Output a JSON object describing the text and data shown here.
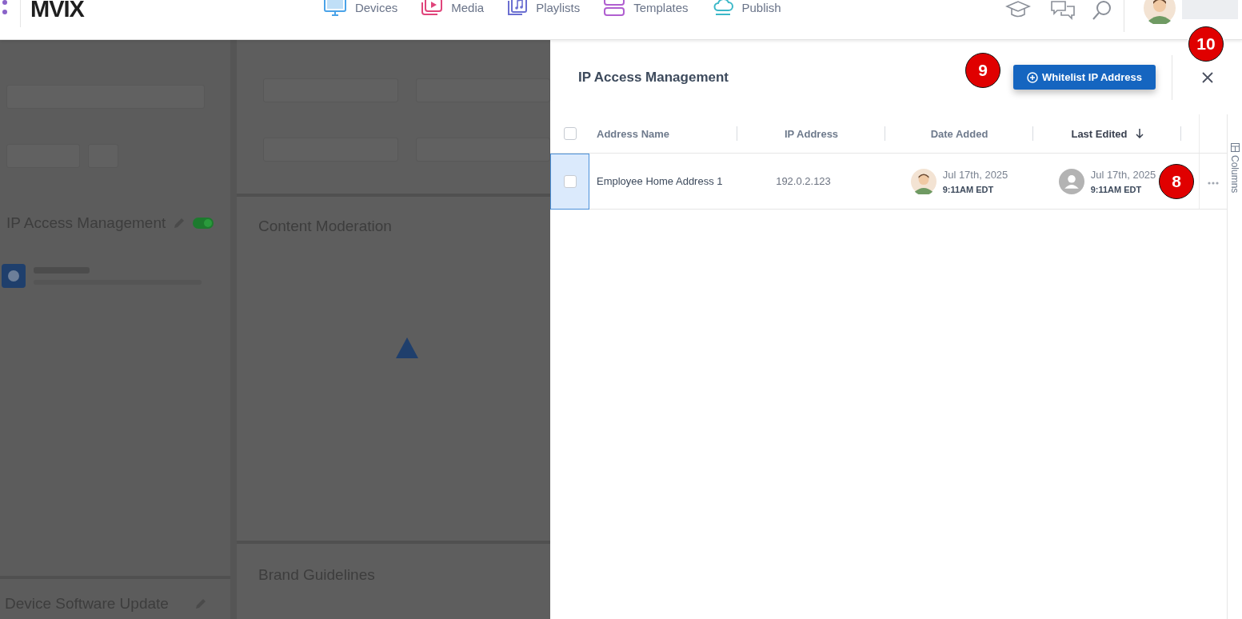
{
  "topbar": {
    "logo": "MVIX",
    "nav": [
      {
        "label": "Devices",
        "color": "#4aa3e8"
      },
      {
        "label": "Media",
        "color": "#e0457b"
      },
      {
        "label": "Playlists",
        "color": "#6b6fd1"
      },
      {
        "label": "Templates",
        "color": "#b05fd0"
      },
      {
        "label": "Publish",
        "color": "#3cb8c8"
      }
    ]
  },
  "background": {
    "left_sections": [
      {
        "title": "IP Access Management",
        "toggle_on": true
      },
      {
        "title": "Device Software Update"
      }
    ],
    "right_sections": [
      {
        "title": "Content Moderation"
      },
      {
        "title": "Brand Guidelines"
      }
    ]
  },
  "panel": {
    "title": "IP Access Management",
    "add_button": "Whitelist IP Address",
    "side_tab": "Columns",
    "table": {
      "select_all_checked": false,
      "columns": [
        {
          "label": "Address Name",
          "sorted": false
        },
        {
          "label": "IP Address",
          "sorted": false
        },
        {
          "label": "Date Added",
          "sorted": false
        },
        {
          "label": "Last Edited",
          "sorted": true
        }
      ],
      "rows": [
        {
          "focused": true,
          "checked": false,
          "address_name": "Employee Home Address 1",
          "ip_address": "192.0.2.123",
          "date_added": {
            "date": "Jul 17th, 2025",
            "time": "9:11AM EDT"
          },
          "last_edited": {
            "date": "Jul 17th, 2025",
            "time": "9:11AM EDT"
          }
        }
      ]
    }
  },
  "callouts": [
    "9",
    "10",
    "8"
  ]
}
